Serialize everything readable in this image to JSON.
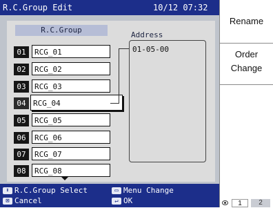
{
  "header": {
    "title": "R.C.Group Edit",
    "datetime": "10/12 07:32"
  },
  "list": {
    "header": "R.C.Group",
    "selected_index": 3,
    "rows": [
      {
        "num": "01",
        "name": "RCG_01"
      },
      {
        "num": "02",
        "name": "RCG_02"
      },
      {
        "num": "03",
        "name": "RCG_03"
      },
      {
        "num": "04",
        "name": "RCG_04"
      },
      {
        "num": "05",
        "name": "RCG_05"
      },
      {
        "num": "06",
        "name": "RCG_06"
      },
      {
        "num": "07",
        "name": "RCG_07"
      },
      {
        "num": "08",
        "name": "RCG_08"
      }
    ]
  },
  "address": {
    "header": "Address",
    "values": [
      "01-05-00"
    ]
  },
  "footer": {
    "select_label": "R.C.Group Select",
    "menu_change_label": "Menu Change",
    "cancel_label": "Cancel",
    "ok_label": "OK"
  },
  "side_buttons": {
    "rename": "Rename",
    "order_line1": "Order",
    "order_line2": "Change"
  },
  "pager": {
    "page1": "1",
    "page2": "2"
  },
  "colors": {
    "title_bar": "#1c2e8a",
    "panel": "#dcdcdc",
    "row_number": "#161616"
  }
}
